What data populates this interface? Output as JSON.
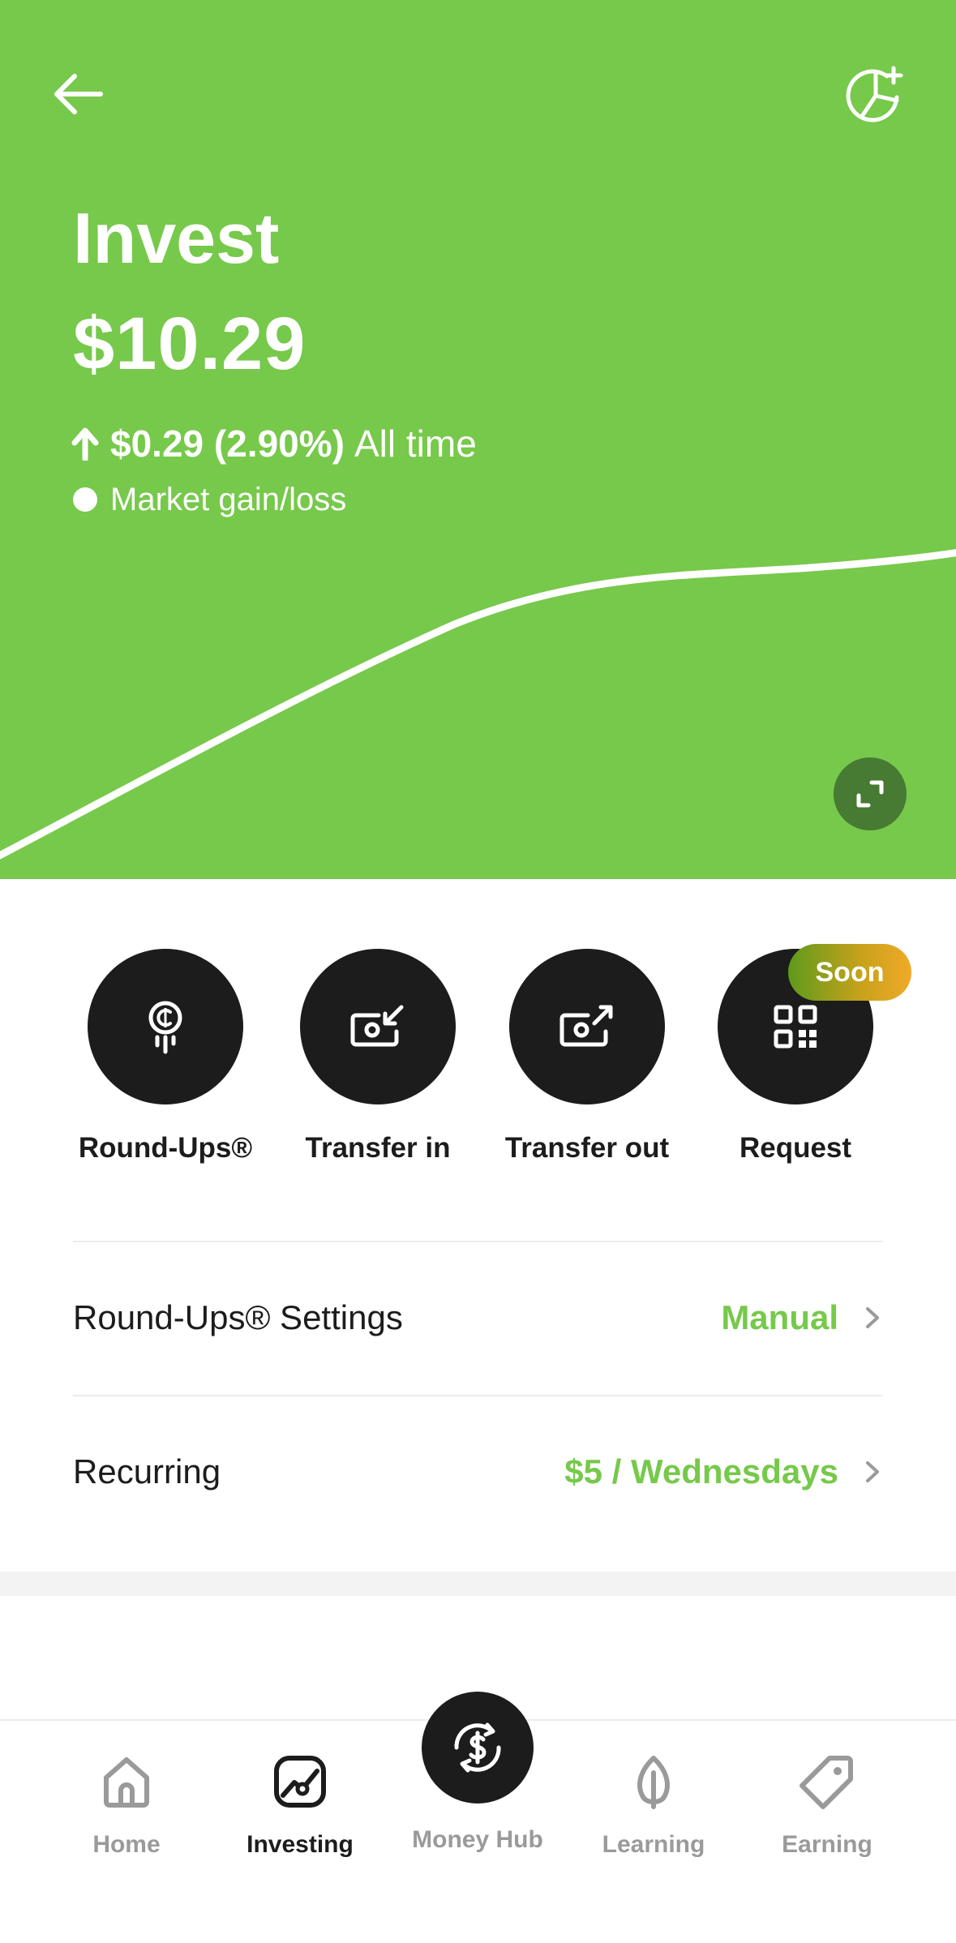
{
  "header": {
    "title": "Invest",
    "balance": "$10.29",
    "gain_amount": "$0.29 (2.90%)",
    "gain_period": "All time",
    "legend_label": "Market gain/loss",
    "back_icon": "arrow-left-icon",
    "add_icon": "portfolio-add-icon",
    "expand_icon": "expand-icon"
  },
  "colors": {
    "brand_green": "#76c94a",
    "dark": "#1c1c1c",
    "expand_button": "#477a33",
    "soon_badge_start": "#5e9a1c",
    "soon_badge_end": "#f0a928",
    "inactive_tab": "#9a9a9a"
  },
  "actions": [
    {
      "label": "Round-Ups®",
      "icon": "round-ups-coin-icon"
    },
    {
      "label": "Transfer in",
      "icon": "transfer-in-icon"
    },
    {
      "label": "Transfer out",
      "icon": "transfer-out-icon"
    },
    {
      "label": "Request",
      "icon": "qr-code-icon",
      "badge": "Soon"
    }
  ],
  "settings": [
    {
      "label": "Round-Ups® Settings",
      "value": "Manual"
    },
    {
      "label": "Recurring",
      "value": "$5 / Wednesdays"
    }
  ],
  "tabs": [
    {
      "label": "Home",
      "icon": "home-icon",
      "active": false
    },
    {
      "label": "Investing",
      "icon": "investing-icon",
      "active": true
    },
    {
      "label": "Money Hub",
      "icon": "dollar-sync-icon",
      "active": false
    },
    {
      "label": "Learning",
      "icon": "leaf-icon",
      "active": false
    },
    {
      "label": "Earning",
      "icon": "tag-icon",
      "active": false
    }
  ]
}
